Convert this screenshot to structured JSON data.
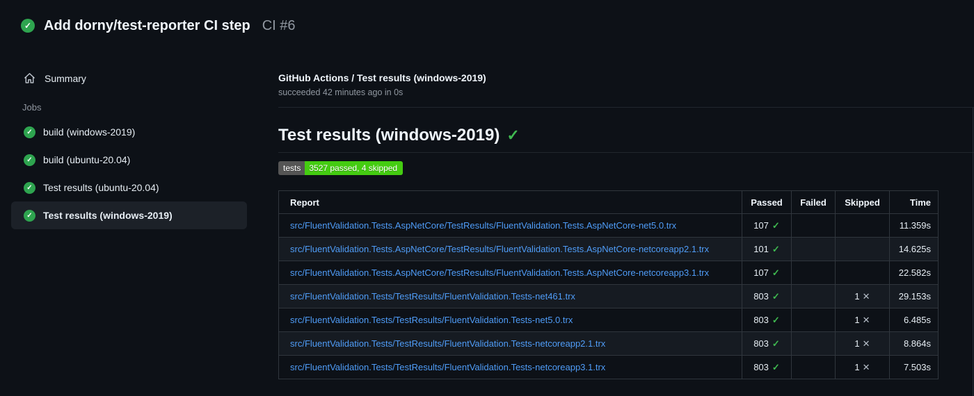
{
  "colors": {
    "background": "#0d1117",
    "row_alt": "#161b22",
    "border": "#30363d",
    "green": "#3fb950",
    "status_circle": "#2ea44f",
    "link": "#4f9cf7",
    "badge_label_bg": "#555555",
    "badge_value_bg": "#44cc11"
  },
  "header": {
    "status_icon": "check-circle-success",
    "title": "Add dorny/test-reporter CI step",
    "run_number": "CI #6"
  },
  "sidebar": {
    "summary_label": "Summary",
    "jobs_label": "Jobs",
    "jobs": [
      {
        "label": "build (windows-2019)",
        "status": "success",
        "selected": false
      },
      {
        "label": "build (ubuntu-20.04)",
        "status": "success",
        "selected": false
      },
      {
        "label": "Test results (ubuntu-20.04)",
        "status": "success",
        "selected": false
      },
      {
        "label": "Test results (windows-2019)",
        "status": "success",
        "selected": true
      }
    ]
  },
  "main": {
    "job_title": "GitHub Actions / Test results (windows-2019)",
    "job_status": "succeeded 42 minutes ago in 0s",
    "section_title": "Test results (windows-2019)",
    "section_status_icon": "check-success",
    "badge": {
      "label": "tests",
      "value": "3527 passed, 4 skipped"
    },
    "table": {
      "columns": [
        "Report",
        "Passed",
        "Failed",
        "Skipped",
        "Time"
      ],
      "rows": [
        {
          "report": "src/FluentValidation.Tests.AspNetCore/TestResults/FluentValidation.Tests.AspNetCore-net5.0.trx",
          "passed": "107",
          "failed": "",
          "skipped": "",
          "time": "11.359s"
        },
        {
          "report": "src/FluentValidation.Tests.AspNetCore/TestResults/FluentValidation.Tests.AspNetCore-netcoreapp2.1.trx",
          "passed": "101",
          "failed": "",
          "skipped": "",
          "time": "14.625s"
        },
        {
          "report": "src/FluentValidation.Tests.AspNetCore/TestResults/FluentValidation.Tests.AspNetCore-netcoreapp3.1.trx",
          "passed": "107",
          "failed": "",
          "skipped": "",
          "time": "22.582s"
        },
        {
          "report": "src/FluentValidation.Tests/TestResults/FluentValidation.Tests-net461.trx",
          "passed": "803",
          "failed": "",
          "skipped": "1",
          "time": "29.153s"
        },
        {
          "report": "src/FluentValidation.Tests/TestResults/FluentValidation.Tests-net5.0.trx",
          "passed": "803",
          "failed": "",
          "skipped": "1",
          "time": "6.485s"
        },
        {
          "report": "src/FluentValidation.Tests/TestResults/FluentValidation.Tests-netcoreapp2.1.trx",
          "passed": "803",
          "failed": "",
          "skipped": "1",
          "time": "8.864s"
        },
        {
          "report": "src/FluentValidation.Tests/TestResults/FluentValidation.Tests-netcoreapp3.1.trx",
          "passed": "803",
          "failed": "",
          "skipped": "1",
          "time": "7.503s"
        }
      ]
    }
  }
}
